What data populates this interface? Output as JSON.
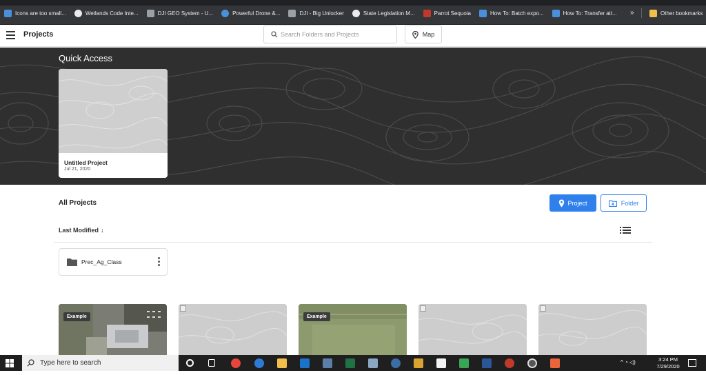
{
  "bookmarks": {
    "items": [
      {
        "label": "Icons are too small...",
        "icon": "bookmark-favicon",
        "color": "#4a90d9"
      },
      {
        "label": "Wetlands Code Inte...",
        "icon": "globe-icon",
        "color": "#e8eaed"
      },
      {
        "label": "DJI GEO System - U...",
        "icon": "drone-icon",
        "color": "#9aa0a6"
      },
      {
        "label": "Powerful Drone &...",
        "icon": "drone-circle-icon",
        "color": "#4a90d9"
      },
      {
        "label": "DJI - Big Unlocker",
        "icon": "drone-icon",
        "color": "#9aa0a6"
      },
      {
        "label": "State Legislation M...",
        "icon": "globe-icon",
        "color": "#e8eaed"
      },
      {
        "label": "Parrot Sequoia",
        "icon": "parrot-icon",
        "color": "#c0392b"
      },
      {
        "label": "How To: Batch expo...",
        "icon": "bookmark-favicon",
        "color": "#4a90d9"
      },
      {
        "label": "How To: Transfer att...",
        "icon": "bookmark-favicon",
        "color": "#4a90d9"
      }
    ],
    "more": "»",
    "other": {
      "label": "Other bookmarks",
      "icon": "folder-icon",
      "color": "#f2c04a"
    }
  },
  "header": {
    "title": "Projects",
    "search_placeholder": "Search Folders and Projects",
    "map_label": "Map"
  },
  "quick_access": {
    "title": "Quick Access",
    "card": {
      "name": "Untitled Project",
      "date": "Jul 21, 2020"
    }
  },
  "all_projects": {
    "title": "All Projects",
    "new_project_label": "Project",
    "new_folder_label": "Folder",
    "sort_label": "Last Modified",
    "sort_arrow": "↓",
    "folders": [
      {
        "name": "Prec_Ag_Class"
      }
    ],
    "projects": [
      {
        "badge": "Example",
        "kind": "aerial-buildings"
      },
      {
        "badge": "",
        "kind": "placeholder"
      },
      {
        "badge": "Example",
        "kind": "aerial-field"
      },
      {
        "badge": "",
        "kind": "placeholder"
      },
      {
        "badge": "",
        "kind": "placeholder"
      }
    ]
  },
  "taskbar": {
    "search_placeholder": "Type here to search",
    "time": "3:24 PM",
    "date": "7/29/2020"
  },
  "colors": {
    "accent": "#2f80ed",
    "hero_bg": "#2f2f2f",
    "bookmarks_bg": "#35363a"
  }
}
